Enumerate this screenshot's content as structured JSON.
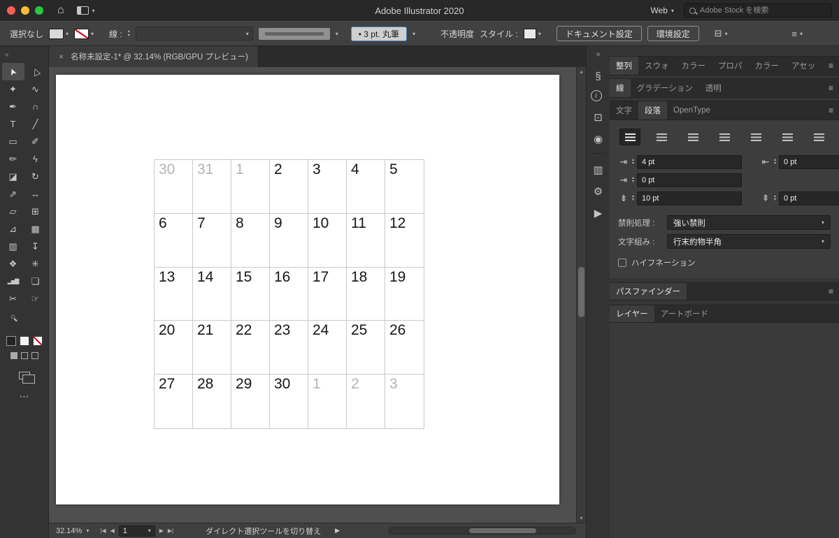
{
  "ui": {
    "chevron": "▾",
    "up": "▴",
    "down": "▾",
    "menu": "≡",
    "collapse": "«",
    "close": "×",
    "ellipsis": "⋯",
    "play": "▶",
    "left": "◀",
    "right": "▶",
    "first": "|◀",
    "last": "▶|",
    "home": "⌂",
    "toolbar_toggle": "⊟",
    "dock": "≡"
  },
  "menubar": {
    "title": "Adobe Illustrator 2020",
    "profile": "Web",
    "search_placeholder": "Adobe Stock を検索"
  },
  "controlbar": {
    "selection_status": "選択なし",
    "stroke_label": "線 :",
    "brush": "• 3 pt. 丸筆",
    "opacity_label": "不透明度",
    "style_label": "スタイル :",
    "document_setup": "ドキュメント設定",
    "preferences": "環境設定"
  },
  "document_tab": {
    "title": "名称未設定-1* @ 32.14% (RGB/GPU プレビュー)"
  },
  "toolbar": {
    "tools": [
      {
        "name": "selection-tool",
        "glyph": "➤",
        "active": true
      },
      {
        "name": "direct-selection-tool",
        "glyph": "▷"
      },
      {
        "name": "magic-wand-tool",
        "glyph": "✦"
      },
      {
        "name": "lasso-tool",
        "glyph": "∿"
      },
      {
        "name": "pen-tool",
        "glyph": "✒"
      },
      {
        "name": "curvature-tool",
        "glyph": "∩"
      },
      {
        "name": "type-tool",
        "glyph": "T"
      },
      {
        "name": "line-segment-tool",
        "glyph": "╱"
      },
      {
        "name": "rectangle-tool",
        "glyph": "▭"
      },
      {
        "name": "paintbrush-tool",
        "glyph": "✐"
      },
      {
        "name": "pencil-tool",
        "glyph": "✏"
      },
      {
        "name": "shaper-tool",
        "glyph": "ϟ"
      },
      {
        "name": "eraser-tool",
        "glyph": "◪"
      },
      {
        "name": "rotate-tool",
        "glyph": "↻"
      },
      {
        "name": "scale-tool",
        "glyph": "⇗"
      },
      {
        "name": "width-tool",
        "glyph": "↔"
      },
      {
        "name": "free-transform-tool",
        "glyph": "▱"
      },
      {
        "name": "shape-builder-tool",
        "glyph": "⊞"
      },
      {
        "name": "perspective-grid-tool",
        "glyph": "⊿"
      },
      {
        "name": "mesh-tool",
        "glyph": "▦"
      },
      {
        "name": "gradient-tool",
        "glyph": "▥"
      },
      {
        "name": "eyedropper-tool",
        "glyph": "↧"
      },
      {
        "name": "blend-tool",
        "glyph": "❖"
      },
      {
        "name": "symbol-sprayer-tool",
        "glyph": "✳"
      },
      {
        "name": "column-graph-tool",
        "glyph": "▂▅▇"
      },
      {
        "name": "artboard-tool",
        "glyph": "❏"
      },
      {
        "name": "slice-tool",
        "glyph": "✂"
      },
      {
        "name": "hand-tool",
        "glyph": "☞"
      },
      {
        "name": "zoom-tool",
        "glyph": "○"
      }
    ]
  },
  "canvas": {
    "calendar_cells": [
      {
        "day": "30",
        "muted": true
      },
      {
        "day": "31",
        "muted": true
      },
      {
        "day": "1",
        "muted": true
      },
      {
        "day": "2"
      },
      {
        "day": "3"
      },
      {
        "day": "4"
      },
      {
        "day": "5"
      },
      {
        "day": "6"
      },
      {
        "day": "7"
      },
      {
        "day": "8"
      },
      {
        "day": "9"
      },
      {
        "day": "10"
      },
      {
        "day": "11"
      },
      {
        "day": "12"
      },
      {
        "day": "13"
      },
      {
        "day": "14"
      },
      {
        "day": "15"
      },
      {
        "day": "16"
      },
      {
        "day": "17"
      },
      {
        "day": "18"
      },
      {
        "day": "19"
      },
      {
        "day": "20"
      },
      {
        "day": "21"
      },
      {
        "day": "22"
      },
      {
        "day": "23"
      },
      {
        "day": "24"
      },
      {
        "day": "25"
      },
      {
        "day": "26"
      },
      {
        "day": "27"
      },
      {
        "day": "28"
      },
      {
        "day": "29"
      },
      {
        "day": "30"
      },
      {
        "day": "1",
        "muted": true
      },
      {
        "day": "2",
        "muted": true
      },
      {
        "day": "3",
        "muted": true
      }
    ]
  },
  "panel_strip": {
    "icons": [
      {
        "name": "link-icon",
        "glyph": "§"
      },
      {
        "name": "info-icon",
        "glyph": "i"
      },
      {
        "name": "libraries-icon",
        "glyph": "⊡"
      },
      {
        "name": "gradient-icon",
        "glyph": "◉",
        "divider_after": true
      },
      {
        "name": "graph-icon",
        "glyph": "▥"
      },
      {
        "name": "gear-icon",
        "glyph": "⚙"
      },
      {
        "name": "actions-icon",
        "glyph": "▶"
      }
    ]
  },
  "panels": {
    "group1_tabs": [
      {
        "label": "整列",
        "active": true
      },
      {
        "label": "スウォ"
      },
      {
        "label": "カラー"
      },
      {
        "label": "プロパ"
      },
      {
        "label": "カラー"
      },
      {
        "label": "アセッ"
      }
    ],
    "group2_tabs": [
      {
        "label": "線",
        "active": true
      },
      {
        "label": "グラデーション"
      },
      {
        "label": "透明"
      }
    ],
    "group3_tabs": [
      {
        "label": "文字"
      },
      {
        "label": "段落",
        "active": true
      },
      {
        "label": "OpenType"
      }
    ],
    "align_buttons": [
      {
        "name": "align-left-button",
        "active": true
      },
      {
        "name": "align-center-button"
      },
      {
        "name": "align-right-button"
      },
      {
        "name": "justify-last-left-button"
      },
      {
        "name": "justify-last-center-button"
      },
      {
        "name": "justify-last-right-button"
      },
      {
        "name": "justify-all-button"
      }
    ],
    "paragraph": {
      "icons": {
        "left_indent": "⇥",
        "right_indent": "⇤",
        "first_line": "⇥",
        "space_before": "⇟",
        "space_after": "⇞"
      },
      "left_indent": "4 pt",
      "right_indent": "0 pt",
      "first_line_indent": "0 pt",
      "space_before": "10 pt",
      "space_after": "0 pt",
      "kinsoku_label": "禁則処理 :",
      "kinsoku_value": "強い禁則",
      "mojikumi_label": "文字組み :",
      "mojikumi_value": "行末約物半角",
      "hyphenation_label": "ハイフネーション"
    },
    "pathfinder_tabs": [
      {
        "label": "パスファインダー",
        "active": true
      }
    ],
    "layers_tabs": [
      {
        "label": "レイヤー",
        "active": true
      },
      {
        "label": "アートボード"
      }
    ]
  },
  "statusbar": {
    "zoom": "32.14%",
    "artboard_number": "1",
    "hint": "ダイレクト選択ツールを切り替え"
  }
}
